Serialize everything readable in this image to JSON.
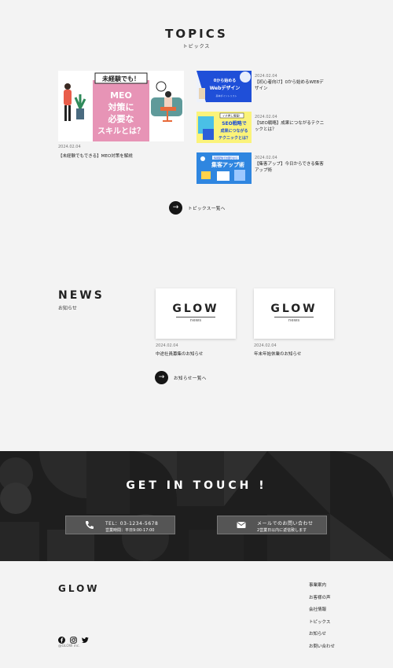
{
  "topics": {
    "title": "TOPICS",
    "subtitle": "トピックス",
    "feature": {
      "date": "2024.02.04",
      "title": "【未経験でもできる】MEO対策を解説",
      "banner_top": "未経験でも！",
      "banner_l1": "MEO",
      "banner_l2": "対策に",
      "banner_l3": "必要な",
      "banner_l4": "スキルとは？"
    },
    "items": [
      {
        "date": "2024.02.04",
        "title": "【初心者向け】0から始めるWEBデザイン",
        "thumb_l1": "0から始める",
        "thumb_l2": "Webデザイン",
        "thumb_l3": "基本ポイントリスト"
      },
      {
        "date": "2024.02.04",
        "title": "【SEO戦略】成果につながるテクニックとは？",
        "thumb_l1": "SEO戦略で",
        "thumb_l2": "成果につながる",
        "thumb_l3": "テクニックとは？",
        "thumb_tag": "イチ押し情報！"
      },
      {
        "date": "2024.02.04",
        "title": "【集客アップ】今日からできる集客アップ術",
        "thumb_l1": "集客アップ術",
        "thumb_l2": "情報配信でお困りなら"
      }
    ],
    "more_label": "トピックス一覧へ"
  },
  "news": {
    "title": "NEWS",
    "subtitle": "お知らせ",
    "cards": [
      {
        "logo": "GLOW",
        "word": "news",
        "date": "2024.02.04",
        "title": "中途社員募集のお知らせ"
      },
      {
        "logo": "GLOW",
        "word": "news",
        "date": "2024.02.04",
        "title": "年末年始休業のお知らせ"
      }
    ],
    "more_label": "お知らせ一覧へ"
  },
  "contact": {
    "title": "GET IN TOUCH !",
    "phone": {
      "line1": "TEL：03-1234-5678",
      "line2": "営業時間：平日9:00-17:00",
      "icon": "phone-icon"
    },
    "mail": {
      "line1": "メールでのお問い合わせ",
      "line2": "2営業日以内に返信致します",
      "icon": "mail-icon"
    }
  },
  "footer": {
    "logo": "GLOW",
    "copyright": "@GLOW inc.",
    "nav": [
      "事業案内",
      "お客様の声",
      "会社情報",
      "トピックス",
      "お知らせ",
      "お問い合わせ"
    ],
    "social": [
      "facebook-icon",
      "instagram-icon",
      "twitter-icon"
    ]
  }
}
